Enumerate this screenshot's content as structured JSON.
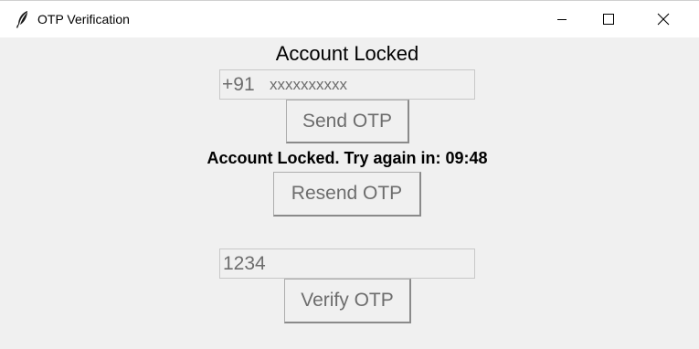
{
  "window": {
    "title": "OTP Verification",
    "icon": "feather-icon",
    "controls": [
      "minimize-icon",
      "maximize-icon",
      "close-icon"
    ]
  },
  "main": {
    "heading": "Account Locked",
    "phone": {
      "prefix": "+91",
      "placeholder": "xxxxxxxxxx"
    },
    "send_otp_label": "Send OTP",
    "status_message": "Account Locked. Try again in: 09:48",
    "resend_otp_label": "Resend OTP",
    "otp": {
      "value": "1234"
    },
    "verify_otp_label": "Verify OTP"
  },
  "colors": {
    "window_background": "#f0f0f0",
    "titlebar_background": "#ffffff",
    "disabled_text": "#6d6d6d",
    "text": "#000000"
  }
}
